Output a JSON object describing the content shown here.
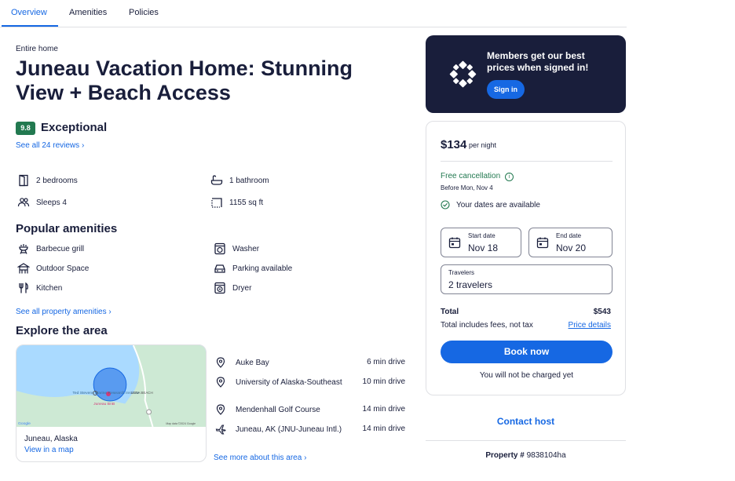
{
  "tabs": [
    "Overview",
    "Amenities",
    "Policies"
  ],
  "property": {
    "kind": "Entire home",
    "title": "Juneau Vacation Home: Stunning View + Beach Access",
    "score": "9.8",
    "score_label": "Exceptional",
    "reviews_link": "See all 24 reviews",
    "facts": [
      "2 bedrooms",
      "1 bathroom",
      "Sleeps 4",
      "1155 sq ft"
    ]
  },
  "amenities": {
    "heading": "Popular amenities",
    "items": [
      "Barbecue grill",
      "Washer",
      "Outdoor Space",
      "Parking available",
      "Kitchen",
      "Dryer"
    ],
    "link": "See all property amenities"
  },
  "area": {
    "heading": "Explore the area",
    "map_labels": [
      "Ted Stevens Marine Research Institute",
      "LENA BEACH",
      "Juneau BnB",
      "Google",
      "Map data ©2024 Google"
    ],
    "city": "Juneau, Alaska",
    "map_link": "View in a map",
    "places": [
      {
        "name": "Auke Bay",
        "dist": "6 min drive"
      },
      {
        "name": "University of Alaska-Southeast",
        "dist": "10 min drive"
      },
      {
        "name": "Mendenhall Golf Course",
        "dist": "14 min drive"
      },
      {
        "name": "Juneau, AK (JNU-Juneau Intl.)",
        "dist": "14 min drive"
      }
    ],
    "more_link": "See more about this area"
  },
  "member": {
    "text": "Members get our best prices when signed in!",
    "button": "Sign in"
  },
  "booking": {
    "price": "$134",
    "per_night": "per night",
    "free_cancel": "Free cancellation",
    "before": "Before Mon, Nov 4",
    "available": "Your dates are available",
    "start_label": "Start date",
    "start_value": "Nov 18",
    "end_label": "End date",
    "end_value": "Nov 20",
    "travelers_label": "Travelers",
    "travelers_value": "2 travelers",
    "total_label": "Total",
    "total_value": "$543",
    "fees_note": "Total includes fees, not tax",
    "price_details": "Price details",
    "book": "Book now",
    "not_charged": "You will not be charged yet"
  },
  "contact": "Contact host",
  "property_number": {
    "label": "Property #",
    "value": "9838104ha"
  },
  "colors": {
    "brand": "#1668e3",
    "navy": "#191e3b",
    "green": "#227950"
  }
}
